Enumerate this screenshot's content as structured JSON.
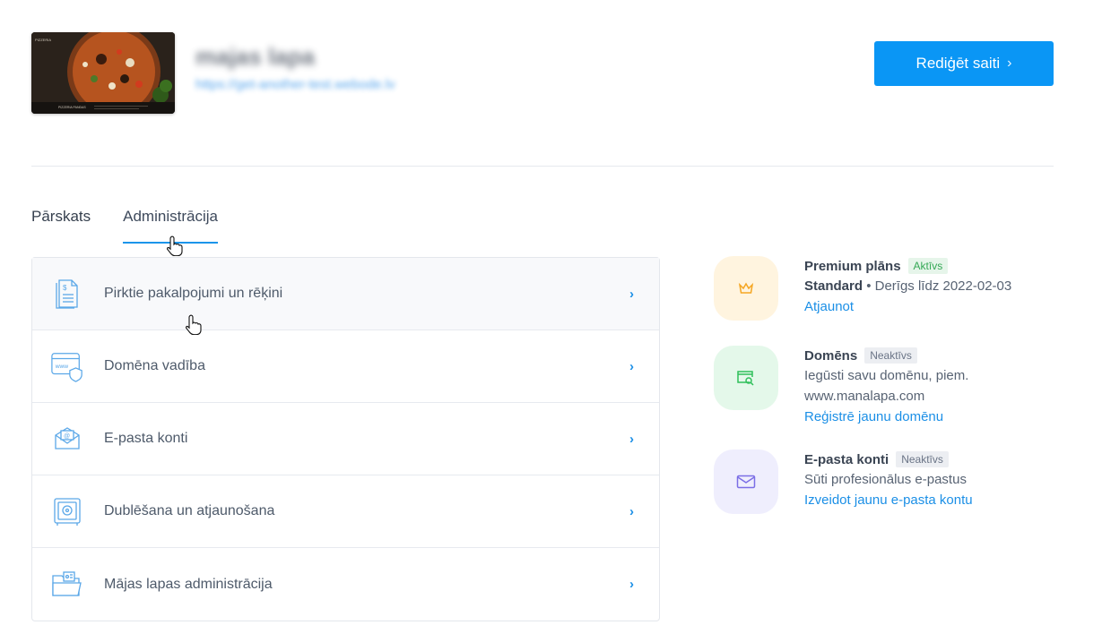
{
  "header": {
    "site_name": "majas lapa",
    "site_url": "https://get-another-test.webode.lv",
    "edit_button_label": "Rediģēt saiti",
    "edit_button_chevron": "›"
  },
  "tabs": [
    {
      "label": "Pārskats",
      "active": false
    },
    {
      "label": "Administrācija",
      "active": true
    }
  ],
  "admin_list": [
    {
      "label": "Pirktie pakalpojumi un rēķini",
      "icon": "invoice-icon"
    },
    {
      "label": "Domēna vadība",
      "icon": "www-shield-icon"
    },
    {
      "label": "E-pasta konti",
      "icon": "email-envelope-icon"
    },
    {
      "label": "Dublēšana un atjaunošana",
      "icon": "safe-icon"
    },
    {
      "label": "Mājas lapas administrācija",
      "icon": "folder-icon"
    }
  ],
  "row_chevron": "›",
  "side": {
    "premium": {
      "title": "Premium plāns",
      "badge": "Aktīvs",
      "plan": "Standard",
      "separator": "•",
      "valid": "Derīgs līdz 2022-02-03",
      "link": "Atjaunot",
      "icon": "crown-icon",
      "color": "#f5a623",
      "bg": "#fff4df"
    },
    "domain": {
      "title": "Domēns",
      "badge": "Neaktīvs",
      "desc_line1": "Iegūsti savu domēnu, piem.",
      "desc_line2": "www.manalapa.com",
      "link": "Reģistrē jaunu domēnu",
      "icon": "domain-search-icon",
      "color": "#2fbf5a",
      "bg": "#e4f8ea"
    },
    "email": {
      "title": "E-pasta konti",
      "badge": "Neaktīvs",
      "desc": "Sūti profesionālus e-pastus",
      "link": "Izveidot jaunu e-pasta kontu",
      "icon": "envelope-icon",
      "color": "#7b6ee6",
      "bg": "#efeefd"
    }
  },
  "thumbnail": {
    "brand": "PIZZERIA",
    "caption": "PIZZERIA PANDAS"
  },
  "colors": {
    "accent": "#0a96f5",
    "link": "#1b8fe6"
  }
}
